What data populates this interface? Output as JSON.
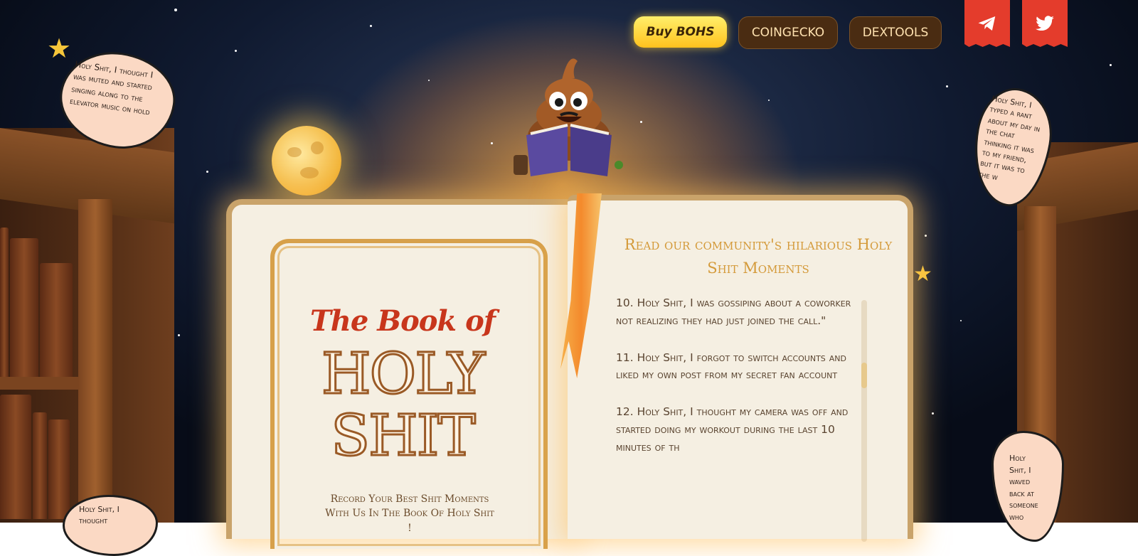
{
  "nav": {
    "buy_label": "Buy BOHS",
    "coingecko_label": "COINGECKO",
    "dextools_label": "DEXTOOLS"
  },
  "social": {
    "telegram_icon": "telegram-icon",
    "twitter_icon": "twitter-icon"
  },
  "bubbles": {
    "top_left": "Holy Shit, I thought I was muted and started singing along to the elevator music on hold",
    "top_right": "Holy Shit, I typed a rant about my day in the chat thinking it was to my friend, but it was to the w",
    "bottom_left": "Holy Shit, I thought",
    "bottom_right": "Holy Shit, I waved back at someone who"
  },
  "left_page": {
    "title_line1": "The Book of",
    "title_line2": "HOLY",
    "title_line3": "SHIT",
    "tagline": "Record Your Best Shit Moments With Us In The Book Of Holy Shit !"
  },
  "right_page": {
    "heading": "Read our community's hilarious Holy Shit Moments",
    "entries": [
      "10. Holy Shit, I was gossiping about a coworker not realizing they had just joined the call.\"",
      "11. Holy Shit, I forgot to switch accounts and liked my own post from my secret fan account",
      "12. Holy Shit, I thought my camera was off and started doing my workout during the last 10 minutes of th"
    ]
  },
  "colors": {
    "accent_yellow": "#ffc21e",
    "nav_dark": "#4a2c12",
    "social_red": "#e43c2c",
    "page_cream": "#f5efe2",
    "title_red": "#c8361c"
  }
}
